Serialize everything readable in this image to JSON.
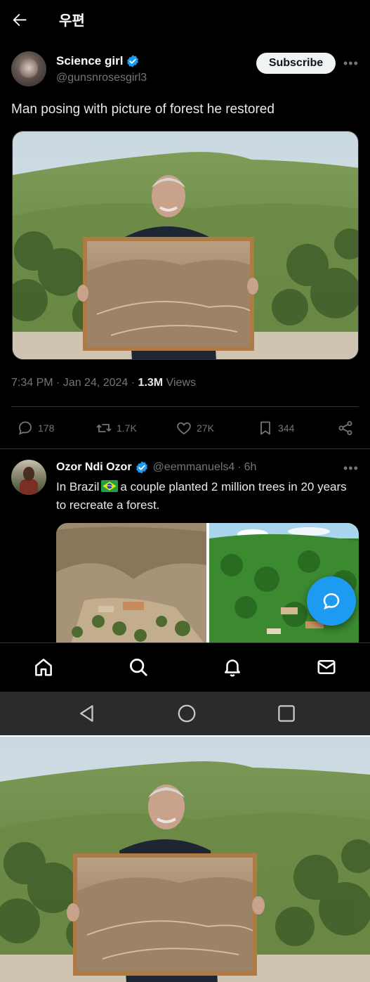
{
  "header": {
    "title": "우편"
  },
  "tweet": {
    "author_name": "Science girl",
    "author_handle": "@gunsnrosesgirl3",
    "subscribe_label": "Subscribe",
    "text": "Man posing with picture of forest he restored",
    "time": "7:34 PM · Jan 24, 2024 · ",
    "views_count": "1.3M",
    "views_label": " Views",
    "replies": "178",
    "reposts": "1.7K",
    "likes": "27K",
    "bookmarks": "344"
  },
  "reply": {
    "author_name": "Ozor Ndi Ozor",
    "author_handle": "@eemmanuels4",
    "time": "6h",
    "text_before_flag": "In Brazil",
    "text_after_flag": "a couple planted 2 million trees in 20 years to recreate a forest."
  },
  "icons": {
    "back": "arrow-left-icon",
    "verified": "verified-badge-icon",
    "more": "more-horizontal-icon",
    "reply": "comment-icon",
    "repost": "repost-icon",
    "like": "heart-icon",
    "bookmark": "bookmark-icon",
    "share": "share-icon",
    "home": "home-icon",
    "search": "search-icon",
    "notifications": "bell-icon",
    "messages": "mail-icon",
    "compose": "compose-reply-icon"
  },
  "colors": {
    "accent": "#1d9bf0",
    "background": "#000000",
    "muted": "#71767b"
  }
}
